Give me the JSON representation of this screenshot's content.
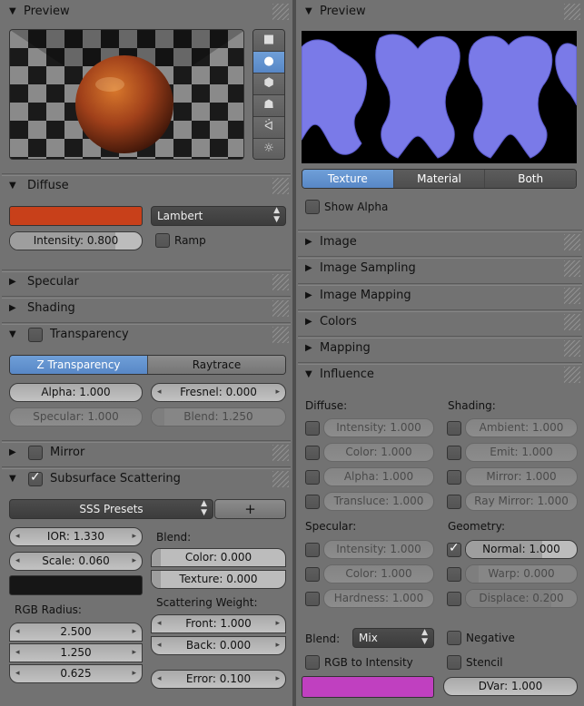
{
  "left": {
    "preview": {
      "header": "Preview",
      "shapes": [
        {
          "name": "flat-icon",
          "glyph": "■"
        },
        {
          "name": "sphere-icon",
          "glyph": "●"
        },
        {
          "name": "cube-icon",
          "glyph": "⬢"
        },
        {
          "name": "monkey-icon",
          "glyph": "☗"
        },
        {
          "name": "hair-icon",
          "glyph": "ᐛ"
        },
        {
          "name": "sphere-lamp-icon",
          "glyph": "☼"
        }
      ]
    },
    "diffuse": {
      "header": "Diffuse",
      "color": "#c8401a",
      "shader": "Lambert",
      "intensity": "Intensity: 0.800",
      "intensity_fraction": 0.8,
      "ramp": "Ramp"
    },
    "specular_header": "Specular",
    "shading_header": "Shading",
    "transparency": {
      "header": "Transparency",
      "tabs": [
        "Z Transparency",
        "Raytrace"
      ],
      "alpha": "Alpha: 1.000",
      "fresnel": "Fresnel: 0.000",
      "specular": "Specular: 1.000",
      "blend": "Blend: 1.250"
    },
    "mirror_header": "Mirror",
    "sss": {
      "header": "Subsurface Scattering",
      "presets": "SSS Presets",
      "add": "+",
      "ior": "IOR: 1.330",
      "scale": "Scale: 0.060",
      "blend_label": "Blend:",
      "blend_color": "Color: 0.000",
      "blend_texture": "Texture: 0.000",
      "swatch_color": "#161616",
      "rgb_radius_label": "RGB Radius:",
      "radius": [
        "2.500",
        "1.250",
        "0.625"
      ],
      "scatter_label": "Scattering Weight:",
      "front": "Front: 1.000",
      "back": "Back: 0.000",
      "error": "Error: 0.100"
    }
  },
  "right": {
    "preview_header": "Preview",
    "tabs": [
      "Texture",
      "Material",
      "Both"
    ],
    "show_alpha": "Show Alpha",
    "collapsed": [
      "Image",
      "Image Sampling",
      "Image Mapping",
      "Colors",
      "Mapping"
    ],
    "influence": {
      "header": "Influence",
      "diffuse_label": "Diffuse:",
      "shading_label": "Shading:",
      "diffuse": [
        "Intensity: 1.000",
        "Color: 1.000",
        "Alpha: 1.000",
        "Transluce: 1.000"
      ],
      "shading": [
        "Ambient: 1.000",
        "Emit: 1.000",
        "Mirror: 1.000",
        "Ray Mirror: 1.000"
      ],
      "specular_label": "Specular:",
      "geometry_label": "Geometry:",
      "specular": [
        "Intensity: 1.000",
        "Color: 1.000",
        "Hardness: 1.000"
      ],
      "geometry": [
        "Normal: 1.000",
        "Warp: 0.000",
        "Displace: 0.200"
      ],
      "blend_label": "Blend:",
      "blend_mode": "Mix",
      "negative": "Negative",
      "rgb_to_intensity": "RGB to Intensity",
      "stencil": "Stencil",
      "color": "#c040c0",
      "dvar": "DVar: 1.000"
    }
  },
  "colors": {
    "accent": "#5887c6",
    "texture_blue": "#7a7ae8"
  }
}
